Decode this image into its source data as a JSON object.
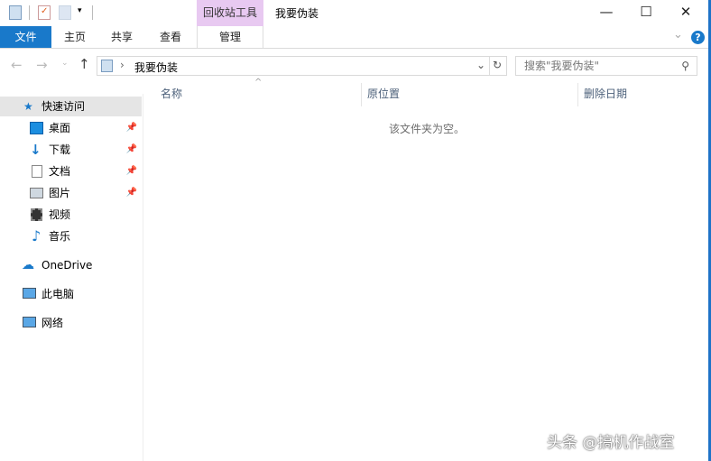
{
  "window": {
    "title": "我要伪装",
    "context_tab": "回收站工具",
    "minimize": "—",
    "maximize": "☐",
    "close": "✕"
  },
  "ribbon": {
    "tabs": [
      "文件",
      "主页",
      "共享",
      "查看",
      "管理"
    ],
    "collapse": "⌄",
    "help": "?"
  },
  "address": {
    "path": "我要伪装",
    "separator": "›",
    "search_placeholder": "搜索\"我要伪装\""
  },
  "nav": {
    "quick_access": "快速访问",
    "items": [
      {
        "label": "桌面",
        "pinned": true
      },
      {
        "label": "下载",
        "pinned": true
      },
      {
        "label": "文档",
        "pinned": true
      },
      {
        "label": "图片",
        "pinned": true
      },
      {
        "label": "视频",
        "pinned": false
      },
      {
        "label": "音乐",
        "pinned": false
      }
    ],
    "onedrive": "OneDrive",
    "this_pc": "此电脑",
    "network": "网络"
  },
  "columns": [
    "名称",
    "原位置",
    "删除日期"
  ],
  "empty_message": "该文件夹为空。",
  "watermark": "头条 @搞机作战室",
  "colors": {
    "accent": "#1979ca",
    "context": "#e8c9f1",
    "selected": "#e5e5e5"
  }
}
